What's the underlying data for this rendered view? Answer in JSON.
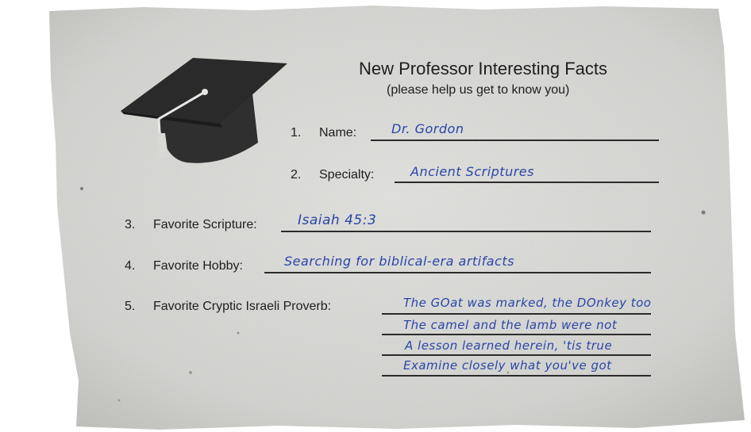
{
  "form": {
    "title": "New Professor Interesting Facts",
    "subtitle": "(please help us get to know you)",
    "items": [
      {
        "number": "1.",
        "label": "Name:",
        "answer": "Dr. Gordon"
      },
      {
        "number": "2.",
        "label": "Specialty:",
        "answer": "Ancient Scriptures"
      },
      {
        "number": "3.",
        "label": "Favorite Scripture:",
        "answer": "Isaiah 45:3"
      },
      {
        "number": "4.",
        "label": "Favorite Hobby:",
        "answer": "Searching for biblical-era artifacts"
      },
      {
        "number": "5.",
        "label": "Favorite Cryptic Israeli Proverb:",
        "answer_lines": [
          "The GOat was marked, the DOnkey too",
          "The camel and the lamb were not",
          "A lesson learned herein, 'tis true",
          "Examine closely what you've got"
        ]
      }
    ]
  },
  "colors": {
    "paper": "#d9d9d6",
    "ink_print": "#1d1d1d",
    "ink_handwriting": "#2a46a8",
    "cap": "#2a2a2a"
  },
  "icons": {
    "graduation_cap": "graduation-cap-icon"
  }
}
